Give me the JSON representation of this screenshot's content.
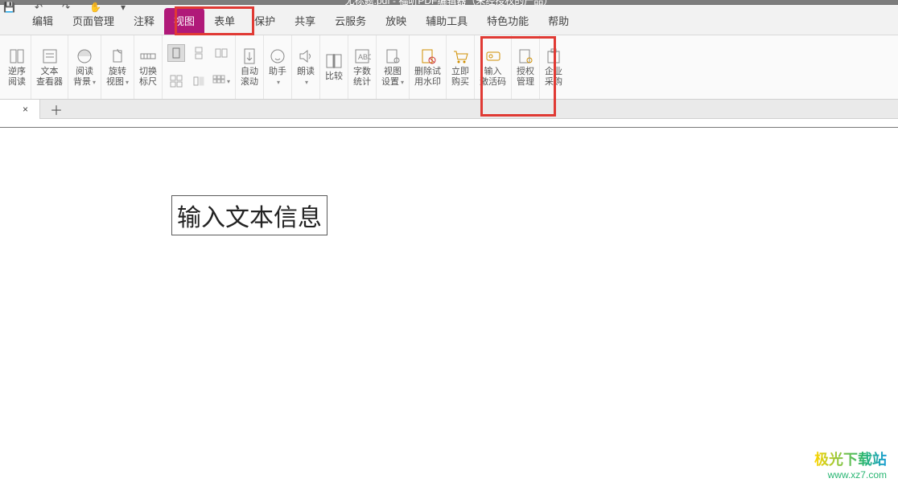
{
  "window": {
    "title": "无标题.pdf - 福昕PDF编辑器（未经授权的产品）"
  },
  "quick": {
    "save": "💾",
    "undo": "↶",
    "redo": "↷",
    "hand": "✋",
    "dd": "▾"
  },
  "tabs": {
    "edit": "编辑",
    "page_mgmt": "页面管理",
    "annotate": "注释",
    "view": "视图",
    "form": "表单",
    "protect": "保护",
    "share": "共享",
    "cloud": "云服务",
    "play": "放映",
    "aux_tools": "辅助工具",
    "special": "特色功能",
    "help": "帮助"
  },
  "ribbon": {
    "reverse_read": "逆序\n阅读",
    "text_viewer": "文本\n查看器",
    "reading_bg": "阅读\n背景",
    "rotate_view": "旋转\n视图",
    "toggle_ruler": "切换\n标尺",
    "auto_scroll": "自动\n滚动",
    "assistant": "助手",
    "read_aloud": "朗读",
    "compare": "比较",
    "word_count": "字数\n统计",
    "view_settings": "视图\n设置",
    "remove_trial_wm": "删除试\n用水印",
    "buy_now": "立即\n购买",
    "enter_activation": "输入\n激活码",
    "license_mgmt": "授权\n管理",
    "enterprise_purchase": "企业\n采购"
  },
  "doc_tab": {
    "close": "×",
    "add": "＋"
  },
  "document": {
    "text_frame": "输入文本信息"
  },
  "watermark": {
    "name": "极光下载站",
    "url": "www.xz7.com"
  }
}
